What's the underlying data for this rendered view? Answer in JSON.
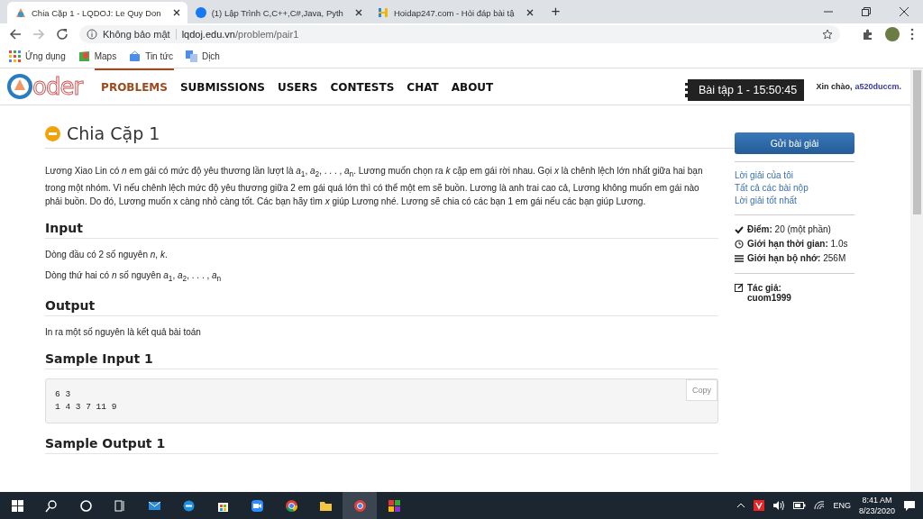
{
  "browser": {
    "tabs": [
      {
        "title": "Chia Cặp 1 - LQDOJ: Le Quy Don",
        "selected": true
      },
      {
        "title": "(1) Lập Trình C,C++,C#,Java, Pyth",
        "selected": false
      },
      {
        "title": "Hoidap247.com - Hỏi đáp bài tậ",
        "selected": false
      }
    ],
    "new_tab": "+",
    "security": "Không bảo mật",
    "url_host": "lqdoj.edu.vn",
    "url_path": "/problem/pair1",
    "bookmarks": [
      "Ứng dụng",
      "Maps",
      "Tin tức",
      "Dịch"
    ]
  },
  "site": {
    "logo_text": "oder",
    "nav": [
      {
        "label": "PROBLEMS",
        "selected": true
      },
      {
        "label": "SUBMISSIONS",
        "selected": false
      },
      {
        "label": "USERS",
        "selected": false
      },
      {
        "label": "CONTESTS",
        "selected": false
      },
      {
        "label": "CHAT",
        "selected": false
      },
      {
        "label": "ABOUT",
        "selected": false
      }
    ],
    "greeting": "Xin chào,",
    "user": "a520duccm.",
    "timer": "Bài tập 1 - 15:50:45"
  },
  "problem": {
    "title": "Chia Cặp 1",
    "statement": "Lương Xiao Lin có *n* em gái có mức độ yêu thương lần lượt là *a*$_{1}$, *a*$_{2}$, . . . , *a*$_{n}$. Lương muốn chọn ra *k* cặp em gái rời nhau. Gọi *x* là chênh lệch lớn nhất giữa hai bạn trong một nhóm. Vì nếu chênh lệch mức độ yêu thương giữa 2 em gái quá lớn thì có thể một em sẽ buồn. Lương là anh trai cao cả, Lương không muốn em gái nào phải buồn. Do đó, Lương muốn x càng nhỏ càng tốt. Các bạn hãy tìm *x* giúp Lương nhé. Lương sẽ chia có các bạn 1 em gái nếu các bạn giúp Lương.",
    "sections": [
      {
        "kind": "text",
        "heading": "Input",
        "paragraphs": [
          "Dòng đầu có 2 số nguyên *n*, *k*.",
          "Dòng thứ hai có *n* số nguyên *a*$_{1}$, *a*$_{2}$, . . . , *a*$_{n}$"
        ]
      },
      {
        "kind": "text",
        "heading": "Output",
        "paragraphs": [
          "In ra một số nguyên là kết quả bài toán"
        ]
      },
      {
        "kind": "code",
        "heading": "Sample Input 1",
        "code": "6 3\n1 4 3 7 11 9",
        "copy": "Copy"
      },
      {
        "kind": "text",
        "heading": "Sample Output 1"
      }
    ]
  },
  "sidebar": {
    "submit": "Gửi bài giải",
    "links": [
      "Lời giải của tôi",
      "Tất cả các bài nộp",
      "Lời giải tốt nhất"
    ],
    "info": [
      {
        "kind": "check",
        "label": "Điểm:",
        "value": "20 (một phần)"
      },
      {
        "kind": "clock",
        "label": "Giới hạn thời gian:",
        "value": "1.0s"
      },
      {
        "kind": "memory",
        "label": "Giới hạn bộ nhớ:",
        "value": "256M"
      }
    ],
    "author_label": "Tác giả:",
    "author": "cuom1999"
  },
  "taskbar": {
    "lang": "ENG",
    "time": "8:41 AM",
    "date": "8/23/2020"
  }
}
